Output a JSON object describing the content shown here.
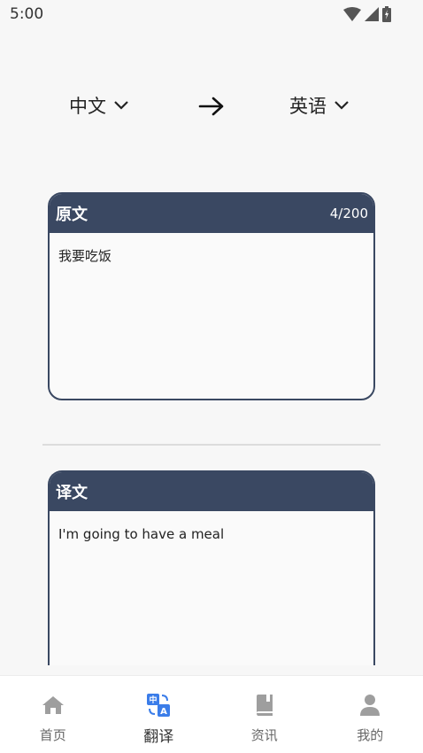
{
  "status_bar": {
    "time": "5:00"
  },
  "language": {
    "source": "中文",
    "target": "英语"
  },
  "source_card": {
    "title": "原文",
    "counter": "4/200",
    "text": "我要吃饭"
  },
  "target_card": {
    "title": "译文",
    "text": "I'm going to have a meal"
  },
  "bottom_nav": {
    "items": [
      {
        "label": "首页",
        "icon": "home-icon"
      },
      {
        "label": "翻译",
        "icon": "translate-icon",
        "active": true
      },
      {
        "label": "资讯",
        "icon": "book-icon"
      },
      {
        "label": "我的",
        "icon": "person-icon"
      }
    ]
  },
  "colors": {
    "card_header": "#3a4862",
    "nav_active": "#3b7de9",
    "nav_inactive": "#9e9e9e"
  }
}
